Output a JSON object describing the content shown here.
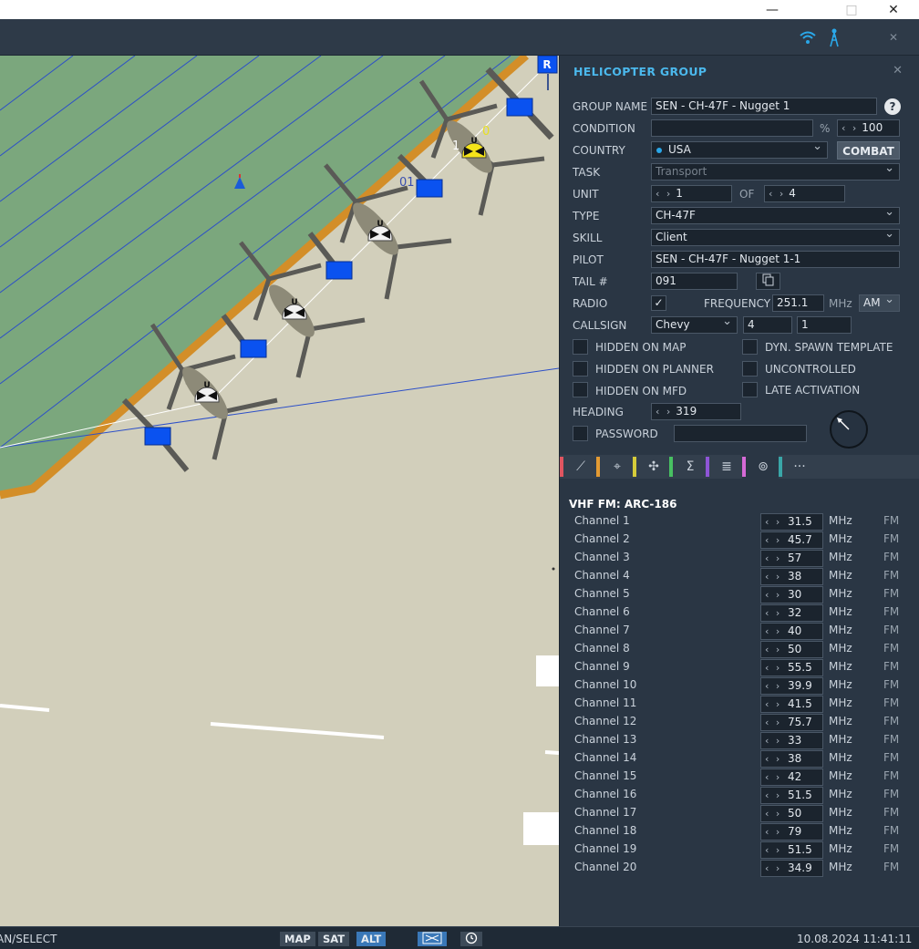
{
  "window": {
    "minimize": "—",
    "maximize": "□",
    "close": "✕"
  },
  "toolbar": {
    "wifi_icon": "wifi-icon",
    "tower_icon": "radio-tower-icon",
    "close": "✕"
  },
  "map": {
    "flight_label_1": "1",
    "flight_label_2": "0",
    "flight_label_3": "01",
    "unit_marker": "U",
    "flag": "R"
  },
  "panel": {
    "title": "HELICOPTER GROUP",
    "close": "✕",
    "group_name_label": "GROUP NAME",
    "group_name": "SEN - CH-47F - Nugget 1",
    "help": "?",
    "condition_label": "CONDITION",
    "condition_value": "",
    "condition_unit": "%",
    "condition_pct": "100",
    "country_label": "COUNTRY",
    "country": "USA",
    "combat_button": "COMBAT",
    "task_label": "TASK",
    "task": "Transport",
    "unit_label": "UNIT",
    "unit_value": "1",
    "of_label": "OF",
    "unit_total": "4",
    "type_label": "TYPE",
    "type": "CH-47F",
    "skill_label": "SKILL",
    "skill": "Client",
    "pilot_label": "PILOT",
    "pilot": "SEN - CH-47F - Nugget 1-1",
    "tail_label": "TAIL #",
    "tail": "091",
    "radio_label": "RADIO",
    "radio_checked": "✓",
    "frequency_label": "FREQUENCY",
    "frequency": "251.1",
    "freq_unit": "MHz",
    "modulation": "AM",
    "callsign_label": "CALLSIGN",
    "callsign_name": "Chevy",
    "callsign_n1": "4",
    "callsign_n2": "1",
    "hidden_on_map": "HIDDEN ON MAP",
    "dyn_spawn": "DYN. SPAWN TEMPLATE",
    "hidden_on_planner": "HIDDEN ON PLANNER",
    "uncontrolled": "UNCONTROLLED",
    "hidden_on_mfd": "HIDDEN ON MFD",
    "late_activation": "LATE ACTIVATION",
    "heading_label": "HEADING",
    "heading": "319",
    "password_label": "PASSWORD",
    "password": ""
  },
  "tabs": [
    {
      "icon": "route-icon",
      "glyph": "⟋",
      "color": "#e05560"
    },
    {
      "icon": "payload-icon",
      "glyph": "⌖",
      "color": "#e39a33"
    },
    {
      "icon": "rotor-icon",
      "glyph": "✣",
      "color": "#d6cc3a"
    },
    {
      "icon": "summary-icon",
      "glyph": "Σ",
      "color": "#48c062"
    },
    {
      "icon": "options-icon",
      "glyph": "≣",
      "color": "#8e55d6"
    },
    {
      "icon": "radio-icon",
      "glyph": "⊚",
      "color": "#d56ad6"
    },
    {
      "icon": "more-icon",
      "glyph": "···",
      "color": "#3aa6a8"
    }
  ],
  "radio": {
    "section_title": "VHF FM: ARC-186",
    "unit": "MHz",
    "mode": "FM",
    "channels": [
      {
        "name": "Channel 1",
        "freq": "31.5"
      },
      {
        "name": "Channel 2",
        "freq": "45.7"
      },
      {
        "name": "Channel 3",
        "freq": "57"
      },
      {
        "name": "Channel 4",
        "freq": "38"
      },
      {
        "name": "Channel 5",
        "freq": "30"
      },
      {
        "name": "Channel 6",
        "freq": "32"
      },
      {
        "name": "Channel 7",
        "freq": "40"
      },
      {
        "name": "Channel 8",
        "freq": "50"
      },
      {
        "name": "Channel 9",
        "freq": "55.5"
      },
      {
        "name": "Channel 10",
        "freq": "39.9"
      },
      {
        "name": "Channel 11",
        "freq": "41.5"
      },
      {
        "name": "Channel 12",
        "freq": "75.7"
      },
      {
        "name": "Channel 13",
        "freq": "33"
      },
      {
        "name": "Channel 14",
        "freq": "38"
      },
      {
        "name": "Channel 15",
        "freq": "42"
      },
      {
        "name": "Channel 16",
        "freq": "51.5"
      },
      {
        "name": "Channel 17",
        "freq": "50"
      },
      {
        "name": "Channel 18",
        "freq": "79"
      },
      {
        "name": "Channel 19",
        "freq": "51.5"
      },
      {
        "name": "Channel 20",
        "freq": "34.9"
      }
    ]
  },
  "statusbar": {
    "mode": "AN/SELECT",
    "map_btn": "MAP",
    "sat_btn": "SAT",
    "alt_btn": "ALT",
    "datetime": "10.08.2024 11:41:11"
  }
}
